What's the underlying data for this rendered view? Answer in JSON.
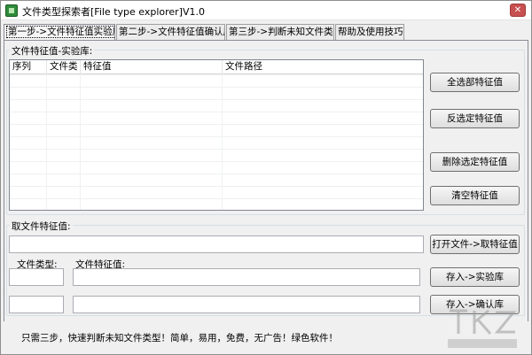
{
  "window": {
    "title": "文件类型探索者[File type explorer]V1.0",
    "close_glyph": "✕"
  },
  "tabs": [
    {
      "label": "第一步->文件特征值实验库",
      "active": true
    },
    {
      "label": "第二步->文件特征值确认库",
      "active": false
    },
    {
      "label": "第三步->判断未知文件类型",
      "active": false
    },
    {
      "label": "帮助及使用技巧",
      "active": false
    }
  ],
  "library_group": {
    "label": "文件特征值-实验库:",
    "columns": [
      "序列",
      "文件类",
      "特征值",
      "文件路径"
    ]
  },
  "library_buttons": {
    "select_all": "全选部特征值",
    "invert_selection": "反选定特征值",
    "delete_selected": "删除选定特征值",
    "clear_all": "清空特征值"
  },
  "extract_group": {
    "label": "取文件特征值:",
    "file_path_value": "",
    "open_file_button": "打开文件->取特征值",
    "file_type_label": "文件类型:",
    "feature_value_label": "文件特征值:",
    "file_type_value": "",
    "feature_value": "",
    "file_type_value_2": "",
    "feature_value_2": "",
    "save_experiment_button": "存入->实验库",
    "save_confirm_button": "存入->确认库"
  },
  "status_bar": {
    "message": "只需三步，快速判断未知文件类型！简单，易用，免费，无广告！绿色软件！"
  }
}
